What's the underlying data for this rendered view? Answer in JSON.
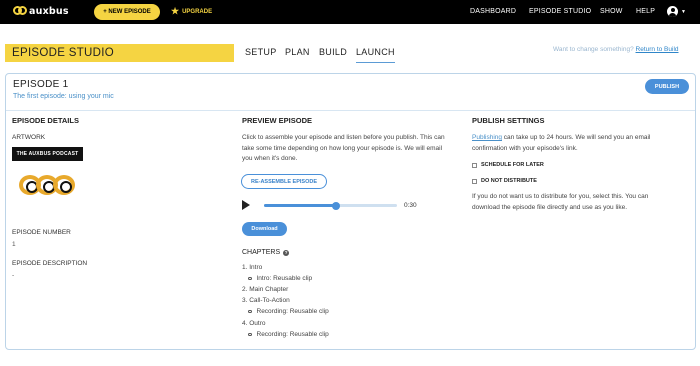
{
  "topbar": {
    "logo_text": "auxbus",
    "new_episode": "+ NEW EPISODE",
    "upgrade": "UPGRADE",
    "nav": [
      "DASHBOARD",
      "EPISODE STUDIO",
      "SHOW",
      "HELP"
    ]
  },
  "studio": {
    "title": "EPISODE STUDIO",
    "tabs": [
      "SETUP",
      "PLAN",
      "BUILD",
      "LAUNCH"
    ],
    "active_tab": "LAUNCH",
    "change_prompt": "Want to change something?",
    "return_link": "Return to Build"
  },
  "episode": {
    "title": "EPISODE 1",
    "subtitle": "The first episode: using your mic",
    "publish_label": "PUBLISH"
  },
  "details": {
    "heading": "EPISODE DETAILS",
    "artwork_label": "ARTWORK",
    "artwork_text": "THE AUXBUS PODCAST",
    "number_label": "EPISODE NUMBER",
    "number_value": "1",
    "description_label": "EPISODE DESCRIPTION",
    "description_value": "-"
  },
  "preview": {
    "heading": "PREVIEW EPISODE",
    "text_lines": [
      "Click to assemble your episode and listen before you publish. This can",
      "take some time depending on how long your episode is. We will email",
      "you when it's done."
    ],
    "reassemble_label": "RE-ASSEMBLE EPISODE",
    "time": "0:30",
    "progress": 0.54,
    "download_label": "Download",
    "chapters_label": "CHAPTERS",
    "chapters": [
      {
        "title": "1. Intro",
        "clip": "Intro: Reusable clip"
      },
      {
        "title": "2. Main Chapter",
        "clip": ""
      },
      {
        "title": "3. Call-To-Action",
        "clip": "Recording: Reusable clip"
      },
      {
        "title": "4. Outro",
        "clip": "Recording: Reusable clip"
      }
    ]
  },
  "publish": {
    "heading": "PUBLISH SETTINGS",
    "link_word": "Publishing",
    "line1_rest": " can take up to 24 hours. We will send you an email",
    "line2": "confirmation with your episode's link.",
    "schedule_label": "SCHEDULE FOR LATER",
    "nodistribute_label": "DO NOT DISTRIBUTE",
    "note_lines": [
      "If you do not want us to distribute for you, select this. You can",
      "download the episode file directly and use as you like."
    ]
  },
  "colors": {
    "accent_yellow": "#f5d442",
    "accent_blue": "#4a90d9",
    "topbar": "#000000"
  }
}
